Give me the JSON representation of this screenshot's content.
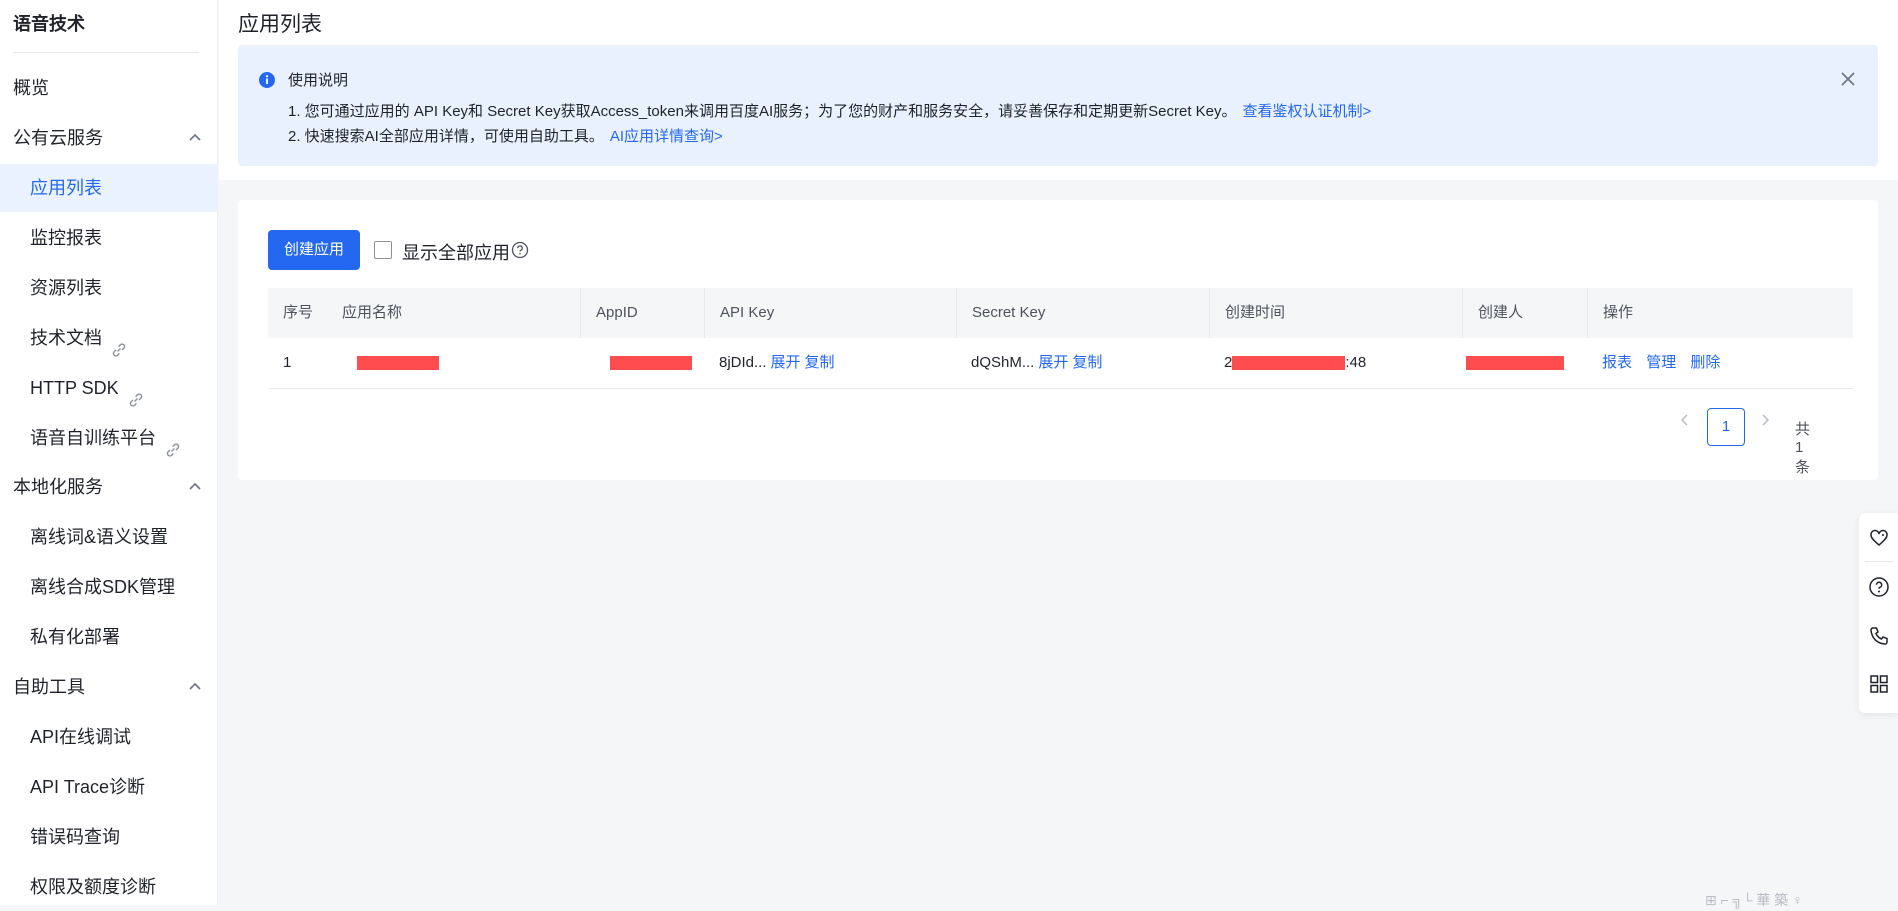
{
  "sidebar": {
    "brand": "语音技术",
    "items": [
      {
        "label": "概览"
      },
      {
        "label": "公有云服务"
      },
      {
        "label": "应用列表"
      },
      {
        "label": "监控报表"
      },
      {
        "label": "资源列表"
      },
      {
        "label": "技术文档"
      },
      {
        "label": "HTTP SDK"
      },
      {
        "label": "语音自训练平台"
      },
      {
        "label": "本地化服务"
      },
      {
        "label": "离线词&语义设置"
      },
      {
        "label": "离线合成SDK管理"
      },
      {
        "label": "私有化部署"
      },
      {
        "label": "自助工具"
      },
      {
        "label": "API在线调试"
      },
      {
        "label": "API Trace诊断"
      },
      {
        "label": "错误码查询"
      },
      {
        "label": "权限及额度诊断"
      }
    ]
  },
  "page": {
    "title": "应用列表"
  },
  "notice": {
    "title": "使用说明",
    "line1": "1. 您可通过应用的 API Key和 Secret Key获取Access_token来调用百度AI服务；为了您的财产和服务安全，请妥善保存和定期更新Secret Key。",
    "line1_link": "查看鉴权认证机制>",
    "line2": "2. 快速搜索AI全部应用详情，可使用自助工具。",
    "line2_link": "AI应用详情查询>"
  },
  "toolbar": {
    "create_label": "创建应用",
    "show_all_label": "显示全部应用"
  },
  "table": {
    "columns": [
      "序号",
      "应用名称",
      "AppID",
      "API Key",
      "Secret Key",
      "创建时间",
      "创建人",
      "操作"
    ],
    "rows": [
      {
        "index": "1",
        "name": "",
        "appid": "",
        "api_key": "8jDId...",
        "secret_key": "dQShM...",
        "created_prefix": "2",
        "created_suffix": ":48",
        "creator": "",
        "expand": "展开",
        "copy": "复制",
        "actions": [
          "报表",
          "管理",
          "删除"
        ]
      }
    ]
  },
  "pagination": {
    "current": "1",
    "total": "共 1 条"
  },
  "icons": {
    "info": "info-icon",
    "close": "close-icon",
    "help": "help-icon",
    "chevron": "chevron-up-icon",
    "external": "external-link-icon",
    "float": [
      "heart-chat-icon",
      "question-icon",
      "phone-icon",
      "grid-icon"
    ]
  },
  "colors": {
    "accent": "#2468f2",
    "notice_bg": "#e8f1fd",
    "redaction": "#ff4d4f"
  },
  "watermark": "⊞ ⌐ ╗└ 華 築 ♀"
}
